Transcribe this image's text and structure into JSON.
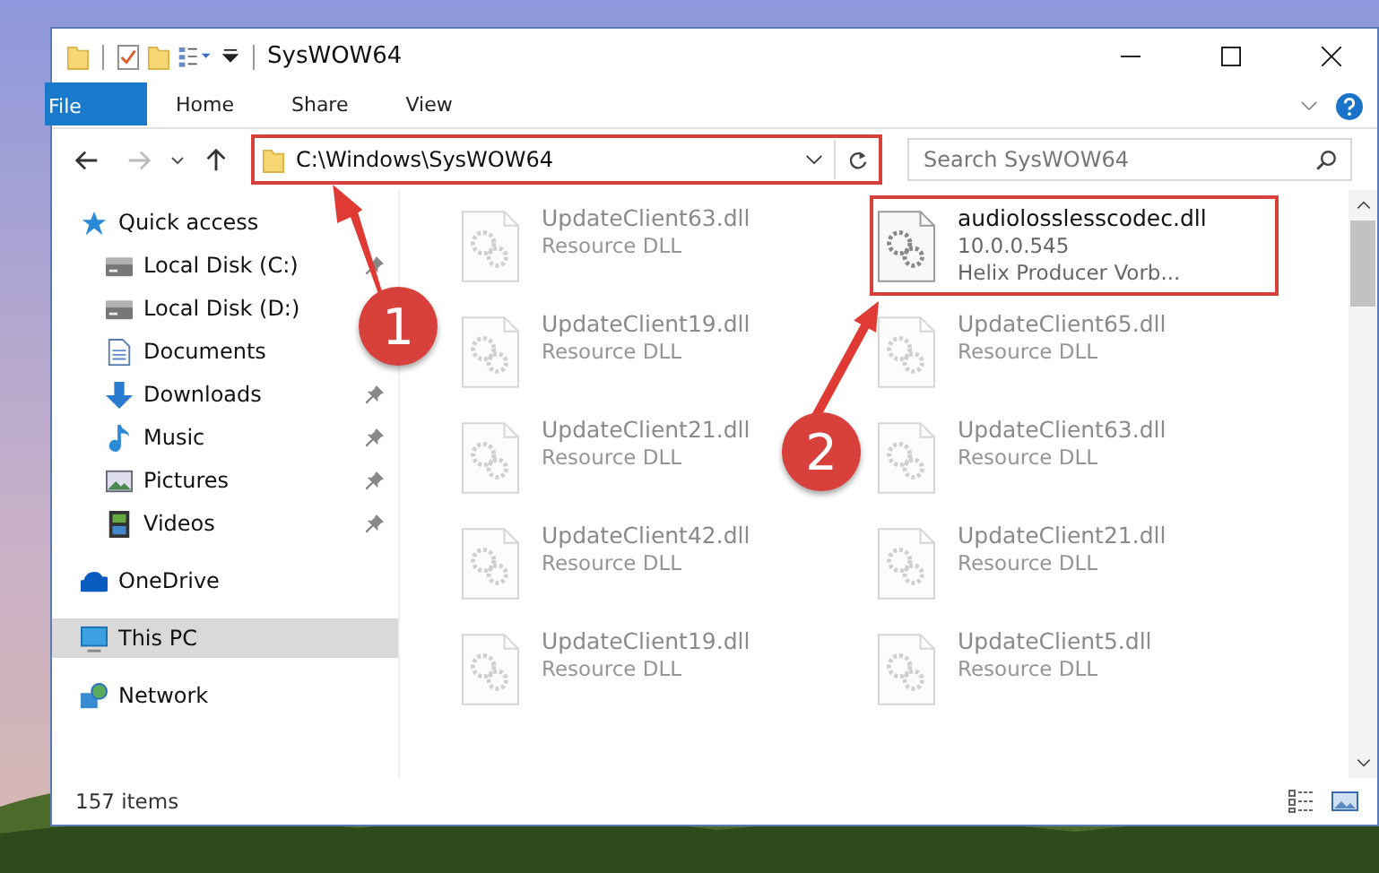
{
  "window": {
    "title": "SysWOW64"
  },
  "ribbon_tabs": [
    {
      "label": "File",
      "kind": "file"
    },
    {
      "label": "Home",
      "kind": "tab"
    },
    {
      "label": "Share",
      "kind": "tab"
    },
    {
      "label": "View",
      "kind": "tab"
    }
  ],
  "address": {
    "path": "C:\\Windows\\SysWOW64",
    "search_placeholder": "Search SysWOW64"
  },
  "sidebar": {
    "items": [
      {
        "label": "Quick access",
        "kind": "star",
        "selected": false,
        "children": [
          {
            "label": "Local Disk (C:)",
            "kind": "drive",
            "pinned": true
          },
          {
            "label": "Local Disk (D:)",
            "kind": "drive",
            "pinned": false
          },
          {
            "label": "Documents",
            "kind": "docs",
            "pinned": false
          },
          {
            "label": "Downloads",
            "kind": "download",
            "pinned": true
          },
          {
            "label": "Music",
            "kind": "music",
            "pinned": true
          },
          {
            "label": "Pictures",
            "kind": "pictures",
            "pinned": true
          },
          {
            "label": "Videos",
            "kind": "videos",
            "pinned": true
          }
        ]
      },
      {
        "label": "OneDrive",
        "kind": "cloud",
        "selected": false
      },
      {
        "label": "This PC",
        "kind": "pc",
        "selected": true
      },
      {
        "label": "Network",
        "kind": "network",
        "selected": false
      }
    ]
  },
  "files": [
    {
      "name": "UpdateClient63.dll",
      "details": [
        "Resource DLL"
      ],
      "faded": true,
      "highlighted": false
    },
    {
      "name": "audiolosslesscodec.dll",
      "details": [
        "10.0.0.545",
        "Helix Producer Vorb..."
      ],
      "faded": false,
      "highlighted": true
    },
    {
      "name": "UpdateClient19.dll",
      "details": [
        "Resource DLL"
      ],
      "faded": true,
      "highlighted": false
    },
    {
      "name": "UpdateClient65.dll",
      "details": [
        "Resource DLL"
      ],
      "faded": true,
      "highlighted": false
    },
    {
      "name": "UpdateClient21.dll",
      "details": [
        "Resource DLL"
      ],
      "faded": true,
      "highlighted": false
    },
    {
      "name": "UpdateClient63.dll",
      "details": [
        "Resource DLL"
      ],
      "faded": true,
      "highlighted": false
    },
    {
      "name": "UpdateClient42.dll",
      "details": [
        "Resource DLL"
      ],
      "faded": true,
      "highlighted": false
    },
    {
      "name": "UpdateClient21.dll",
      "details": [
        "Resource DLL"
      ],
      "faded": true,
      "highlighted": false
    },
    {
      "name": "UpdateClient19.dll",
      "details": [
        "Resource DLL"
      ],
      "faded": true,
      "highlighted": false
    },
    {
      "name": "UpdateClient5.dll",
      "details": [
        "Resource DLL"
      ],
      "faded": true,
      "highlighted": false
    }
  ],
  "status_bar": {
    "item_count": "157 items"
  },
  "callouts": [
    {
      "number": "1"
    },
    {
      "number": "2"
    }
  ]
}
